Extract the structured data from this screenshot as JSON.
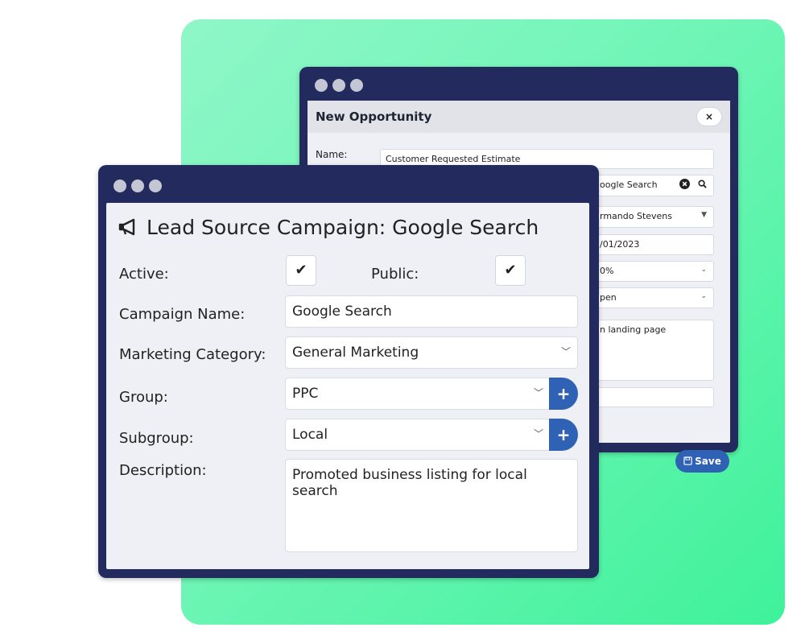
{
  "back_window": {
    "title": "New Opportunity",
    "close_label": "×",
    "name_label": "Name:",
    "name_value": "Customer Requested Estimate",
    "lead_source_value": "oogle Search",
    "owner_value": "rmando Stevens",
    "date_value": "/01/2023",
    "probability_value": "0%",
    "status_value": "pen",
    "notes_value": "n landing page",
    "save_label": "Save"
  },
  "front_window": {
    "title": "Lead Source Campaign: Google Search",
    "active_label": "Active:",
    "public_label": "Public:",
    "check_mark": "✔",
    "campaign_name_label": "Campaign Name:",
    "campaign_name_value": "Google Search",
    "marketing_category_label": "Marketing Category:",
    "marketing_category_value": "General Marketing",
    "group_label": "Group:",
    "group_value": "PPC",
    "subgroup_label": "Subgroup:",
    "subgroup_value": "Local",
    "description_label": "Description:",
    "description_value": "Promoted business listing for local search",
    "add_label": "+"
  },
  "colors": {
    "window_frame": "#232b5e",
    "panel_bg": "#eef0f5",
    "accent_blue": "#2f62b4",
    "gradient_start": "#8ff7c8",
    "gradient_end": "#3ff29a"
  },
  "icons": {
    "megaphone": "megaphone-icon",
    "clear": "clear-circle-icon",
    "search": "search-icon",
    "save": "floppy-disk-icon",
    "chevron": "chevron-down-icon",
    "check": "check-icon",
    "plus": "plus-icon"
  }
}
